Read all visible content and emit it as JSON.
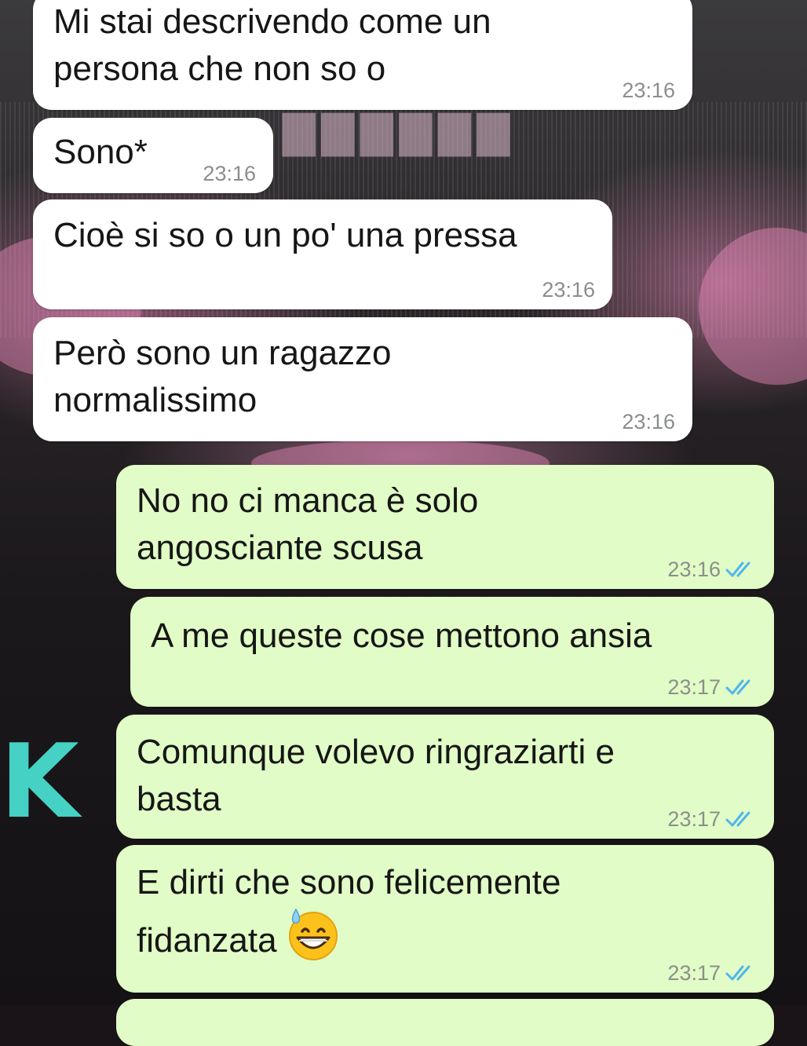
{
  "conversation": {
    "messages": [
      {
        "direction": "incoming",
        "text": "Mi stai descrivendo come un\npersona che non so o",
        "time": "23:16"
      },
      {
        "direction": "incoming",
        "text": "Sono*",
        "time": "23:16"
      },
      {
        "direction": "incoming",
        "text": "Cioè si so o un po' una pressa",
        "time": "23:16"
      },
      {
        "direction": "incoming",
        "text": "Però sono un ragazzo\nnormalissimo",
        "time": "23:16"
      },
      {
        "direction": "outgoing",
        "text": "No no ci manca è solo\nangosciante scusa",
        "time": "23:16",
        "status": "read"
      },
      {
        "direction": "outgoing",
        "text": "A me queste cose mettono ansia",
        "time": "23:17",
        "status": "read"
      },
      {
        "direction": "outgoing",
        "text": "Comunque volevo ringraziarti e\nbasta",
        "time": "23:17",
        "status": "read"
      },
      {
        "direction": "outgoing",
        "text": "E dirti che sono felicemente\nfidanzata",
        "time": "23:17",
        "status": "read",
        "emoji": "grinning-face-with-sweat"
      }
    ]
  },
  "colors": {
    "incoming_bubble": "#ffffff",
    "outgoing_bubble": "#e1fcc6",
    "timestamp": "#8b8f8b",
    "read_ticks": "#4fb6ec"
  }
}
